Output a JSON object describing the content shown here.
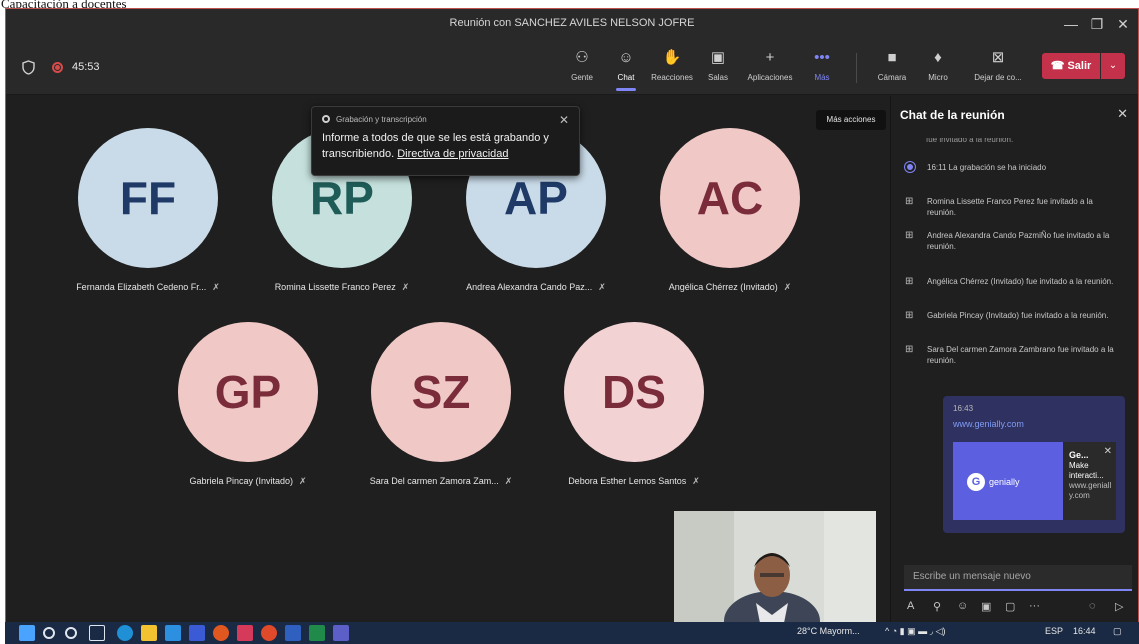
{
  "document": {
    "caption": "Capacitación a docentes"
  },
  "window": {
    "title": "Reunión con SANCHEZ AVILES NELSON JOFRE",
    "minimize": "—",
    "maximize": "❐",
    "close": "✕"
  },
  "toolbar": {
    "timer": "45:53",
    "buttons": [
      {
        "label": "Gente",
        "icon": "people-icon"
      },
      {
        "label": "Chat",
        "icon": "chat-icon"
      },
      {
        "label": "Reacciones",
        "icon": "reactions-icon"
      },
      {
        "label": "Salas",
        "icon": "rooms-icon"
      },
      {
        "label": "Aplicaciones",
        "icon": "add-icon"
      },
      {
        "label": "Más",
        "icon": "more-icon"
      },
      {
        "label": "Cámara",
        "icon": "camera-icon"
      },
      {
        "label": "Micro",
        "icon": "mic-icon"
      },
      {
        "label": "Dejar de co...",
        "icon": "stop-share-icon"
      }
    ],
    "leave_label": "Salir",
    "more_tooltip": "Más acciones"
  },
  "toast": {
    "header": "Grabación y transcripción",
    "body": "Informe a todos de que se les está grabando y transcribiendo.",
    "link": "Directiva de privacidad"
  },
  "participants": [
    {
      "initials": "FF",
      "name": "Fernanda Elizabeth Cedeno Fr..."
    },
    {
      "initials": "RP",
      "name": "Romina Lissette Franco Perez"
    },
    {
      "initials": "AP",
      "name": "Andrea Alexandra Cando Paz..."
    },
    {
      "initials": "AC",
      "name": "Angélica Chérrez (Invitado)"
    },
    {
      "initials": "GP",
      "name": "Gabriela Pincay (Invitado)"
    },
    {
      "initials": "SZ",
      "name": "Sara Del carmen Zamora Zam..."
    },
    {
      "initials": "DS",
      "name": "Debora Esther Lemos Santos"
    }
  ],
  "chat": {
    "title": "Chat de la reunión",
    "cut_line": "fue invitado a la reunión.",
    "events": [
      "16:11   La grabación se ha iniciado",
      "Romina Lissette Franco Perez fue invitado a la reunión.",
      "Andrea Alexandra Cando PazmiÑo fue invitado a la reunión.",
      "Angélica Chérrez (Invitado) fue invitado a la reunión.",
      "Gabriela Pincay (Invitado) fue invitado a la reunión.",
      "Sara Del carmen Zamora Zambrano fue invitado a la reunión."
    ],
    "message": {
      "time": "16:43",
      "url": "www.genially.com",
      "card_logo": "genially",
      "card_title": "Ge...",
      "card_desc": "Make interacti...",
      "card_domain": "www.genially.com"
    },
    "compose_placeholder": "Escribe un mensaje nuevo"
  },
  "taskbar": {
    "weather": "28°C  Mayorm...",
    "language": "ESP",
    "clock": "16:44"
  }
}
